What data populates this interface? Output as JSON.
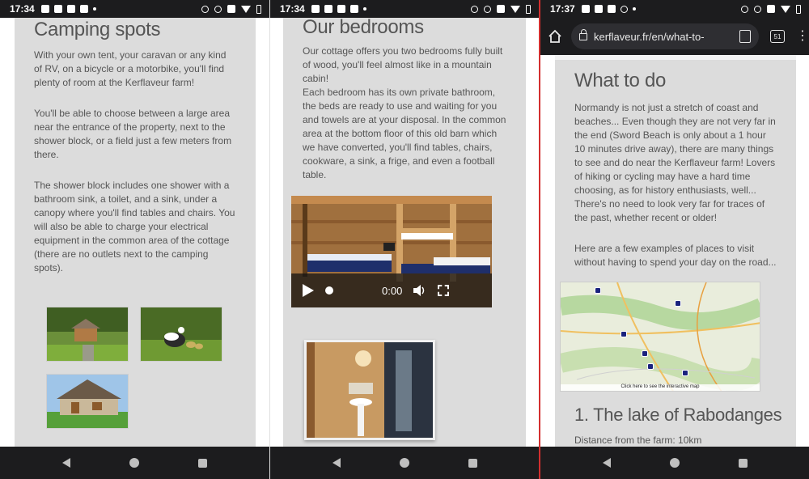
{
  "screens": [
    {
      "status": {
        "time": "17:34"
      },
      "title": "Camping spots",
      "paragraphs": [
        "With your own tent, your caravan or any kind of RV, on a bicycle or a motorbike, you'll find plenty of room at the Kerflaveur farm!",
        "You'll be able to choose between a large area near the entrance of the property, next to the shower block, or a field just a few meters from there.",
        "The shower block includes one shower with a bathroom sink, a toilet, and a sink, under a canopy where you'll find tables and chairs. You will also be able to charge your electrical equipment in the common area of the cottage (there are no outlets next to the camping spots)."
      ]
    },
    {
      "status": {
        "time": "17:34"
      },
      "title": "Our bedrooms",
      "paragraphs": [
        "Our cottage offers you two bedrooms fully built of wood, you'll feel almost like in a mountain cabin!",
        "Each bedroom has its own private bathroom, the beds are ready to use and waiting for you and towels are at your disposal. In the common area at the bottom floor of this old barn which we have converted, you'll find tables, chairs, cookware, a sink, a frige, and even a football table."
      ],
      "video": {
        "time": "0:00"
      }
    },
    {
      "status": {
        "time": "17:37"
      },
      "browser": {
        "url": "kerflaveur.fr/en/what-to-",
        "tab_count": "51"
      },
      "title": "What to do",
      "paragraphs": [
        "Normandy is not just a stretch of coast and beaches... Even though they are not very far in the end (Sword Beach is only about a 1 hour 10 minutes drive away), there are many things to see and do near the Kerflaveur farm! Lovers of hiking or cycling may have a hard time choosing, as for history enthusiasts, well... There's no need to look very far for traces of the past, whether recent or older!",
        "Here are a few examples of places to visit without having to spend your day on the road..."
      ],
      "map_caption": "Click here to see the interactive map",
      "section_title": "1. The lake of Rabodanges",
      "distance": "Distance from the farm: 10km"
    }
  ]
}
